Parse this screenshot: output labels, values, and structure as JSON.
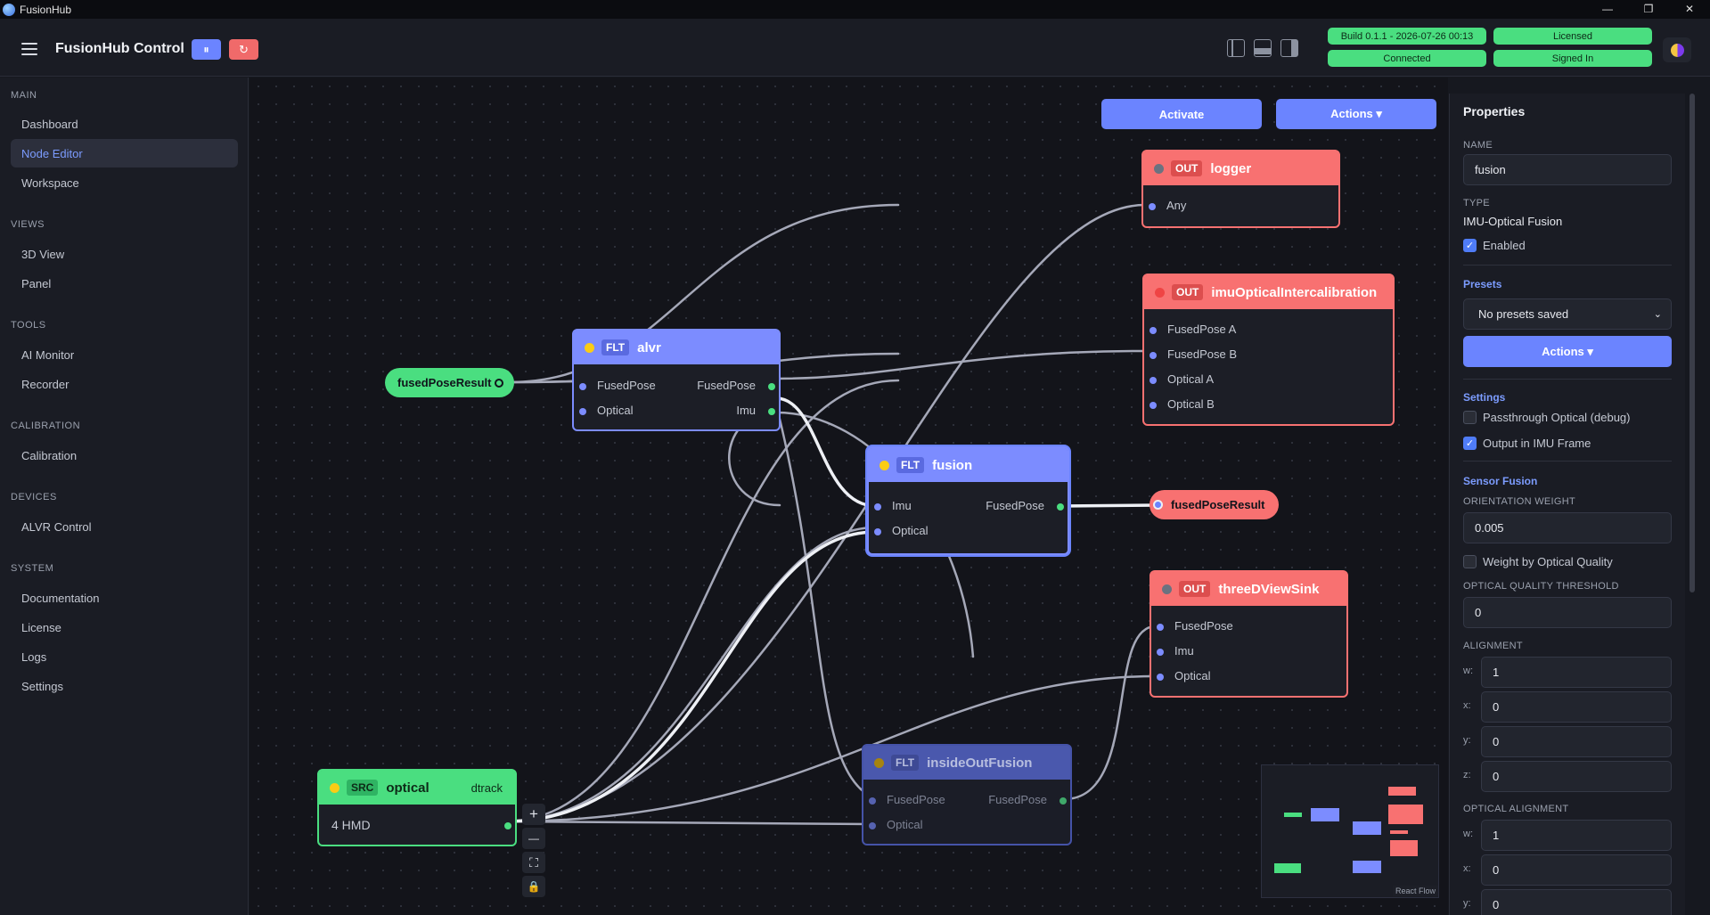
{
  "window": {
    "title": "FusionHub",
    "minimize": "—",
    "maximize": "❐",
    "close": "✕"
  },
  "header": {
    "title": "FusionHub Control",
    "pause_icon": "⏸",
    "restart_icon": "↻",
    "status": {
      "build": "Build 0.1.1 - 2026-07-26 00:13",
      "license": "Licensed",
      "connection": "Connected",
      "auth": "Signed In"
    }
  },
  "sidebar": {
    "sections": [
      {
        "title": "MAIN",
        "items": [
          "Dashboard",
          "Node Editor",
          "Workspace"
        ]
      },
      {
        "title": "VIEWS",
        "items": [
          "3D View",
          "Panel"
        ]
      },
      {
        "title": "TOOLS",
        "items": [
          "AI Monitor",
          "Recorder"
        ]
      },
      {
        "title": "CALIBRATION",
        "items": [
          "Calibration"
        ]
      },
      {
        "title": "DEVICES",
        "items": [
          "ALVR Control"
        ]
      },
      {
        "title": "SYSTEM",
        "items": [
          "Documentation",
          "License",
          "Logs",
          "Settings"
        ]
      }
    ],
    "active": "Node Editor"
  },
  "canvas": {
    "activate_label": "Activate",
    "actions_label": "Actions ▾",
    "attribution": "React Flow",
    "zoom": {
      "in": "+",
      "out": "—",
      "fit": "⛶",
      "lock": "🔒"
    },
    "external": {
      "input": "fusedPoseResult",
      "output": "fusedPoseResult"
    },
    "nodes": {
      "alvr": {
        "tag": "FLT",
        "name": "alvr",
        "inputs": [
          "FusedPose",
          "Optical"
        ],
        "outputs": [
          "FusedPose",
          "Imu"
        ]
      },
      "fusion": {
        "tag": "FLT",
        "name": "fusion",
        "inputs": [
          "Imu",
          "Optical"
        ],
        "outputs": [
          "FusedPose"
        ]
      },
      "logger": {
        "tag": "OUT",
        "name": "logger",
        "inputs": [
          "Any"
        ]
      },
      "imuOptical": {
        "tag": "OUT",
        "name": "imuOpticalIntercalibration",
        "inputs": [
          "FusedPose A",
          "FusedPose B",
          "Optical A",
          "Optical B"
        ]
      },
      "threeD": {
        "tag": "OUT",
        "name": "threeDViewSink",
        "inputs": [
          "FusedPose",
          "Imu",
          "Optical"
        ]
      },
      "insideOut": {
        "tag": "FLT",
        "name": "insideOutFusion",
        "inputs": [
          "FusedPose",
          "Optical"
        ],
        "outputs": [
          "FusedPose"
        ]
      },
      "optical": {
        "tag": "SRC",
        "name": "optical",
        "subtype": "dtrack",
        "body": "4 HMD"
      }
    }
  },
  "properties": {
    "title": "Properties",
    "name_label": "NAME",
    "name_value": "fusion",
    "type_label": "TYPE",
    "type_value": "IMU-Optical Fusion",
    "enabled_label": "Enabled",
    "presets_title": "Presets",
    "presets_select": "No presets saved",
    "actions_label": "Actions ▾",
    "settings_title": "Settings",
    "passthrough_label": "Passthrough Optical (debug)",
    "output_imu_label": "Output in IMU Frame",
    "sensor_fusion_title": "Sensor Fusion",
    "orientation_weight_label": "ORIENTATION WEIGHT",
    "orientation_weight_value": "0.005",
    "weight_quality_label": "Weight by Optical Quality",
    "quality_threshold_label": "OPTICAL QUALITY THRESHOLD",
    "quality_threshold_value": "0",
    "alignment_label": "ALIGNMENT",
    "alignment": [
      {
        "axis": "w:",
        "value": "1"
      },
      {
        "axis": "x:",
        "value": "0"
      },
      {
        "axis": "y:",
        "value": "0"
      },
      {
        "axis": "z:",
        "value": "0"
      }
    ],
    "optical_alignment_label": "OPTICAL ALIGNMENT",
    "optical_alignment": [
      {
        "axis": "w:",
        "value": "1"
      },
      {
        "axis": "x:",
        "value": "0"
      },
      {
        "axis": "y:",
        "value": "0"
      }
    ]
  },
  "colors": {
    "accent": "#6b84ff",
    "output_node": "#f87171",
    "source_node": "#4ade80",
    "status_green": "#4ade80"
  }
}
